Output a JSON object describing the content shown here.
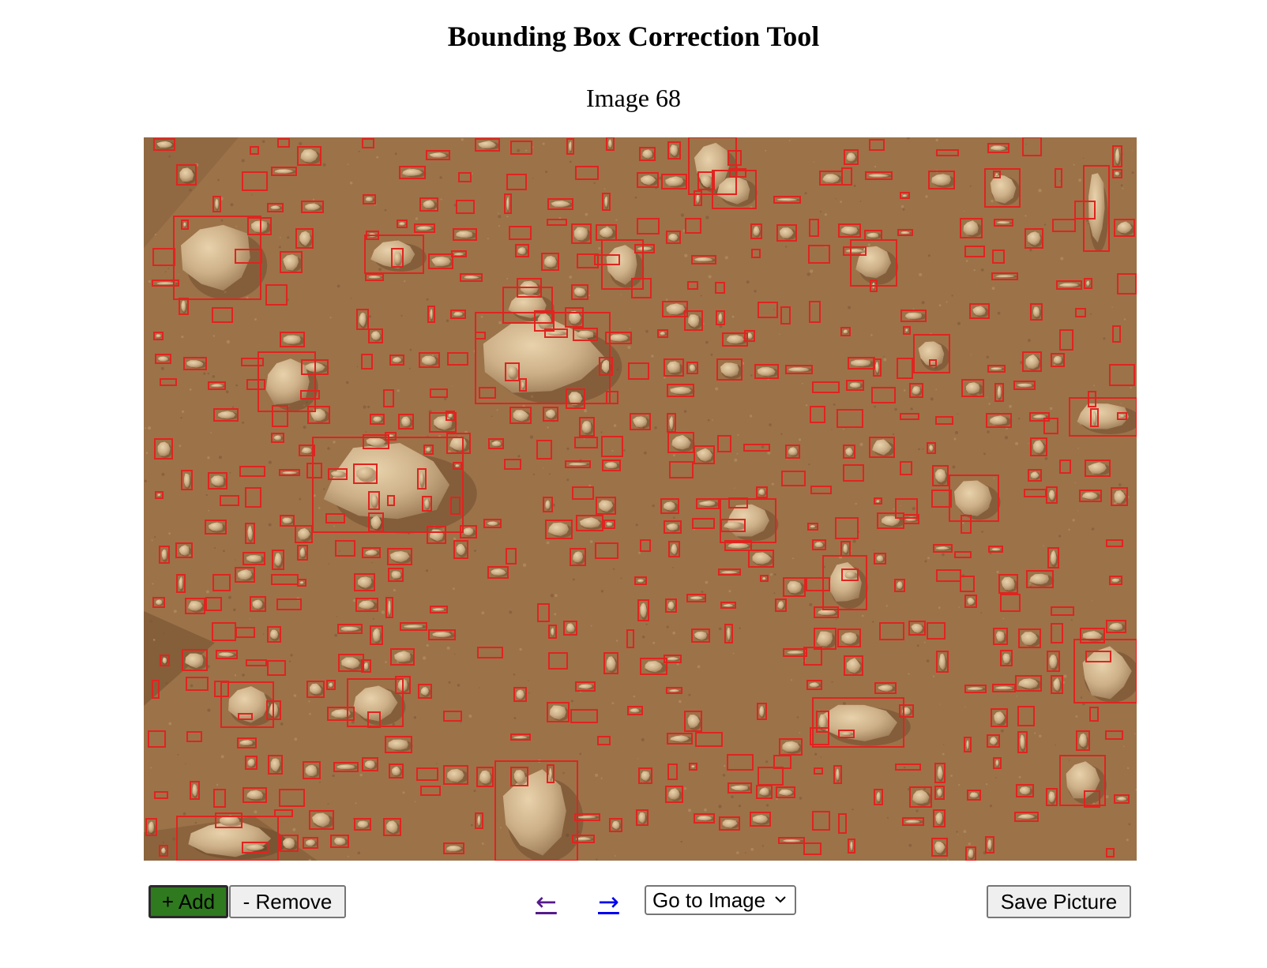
{
  "page": {
    "title": "Bounding Box Correction Tool",
    "image_label": "Image 68"
  },
  "canvas": {
    "scene": "mars-rocky-ground",
    "background_color": "#9c7249",
    "box_color": "#e0241f"
  },
  "toolbar": {
    "add_label": "+ Add",
    "remove_label": "- Remove",
    "prev_label": "←",
    "next_label": "→",
    "goto_label": "Go to Image",
    "save_label": "Save Picture"
  },
  "colors": {
    "add_button_bg": "#2f7a1f",
    "prev_link": "#551a8b",
    "next_link": "#0000ee"
  }
}
